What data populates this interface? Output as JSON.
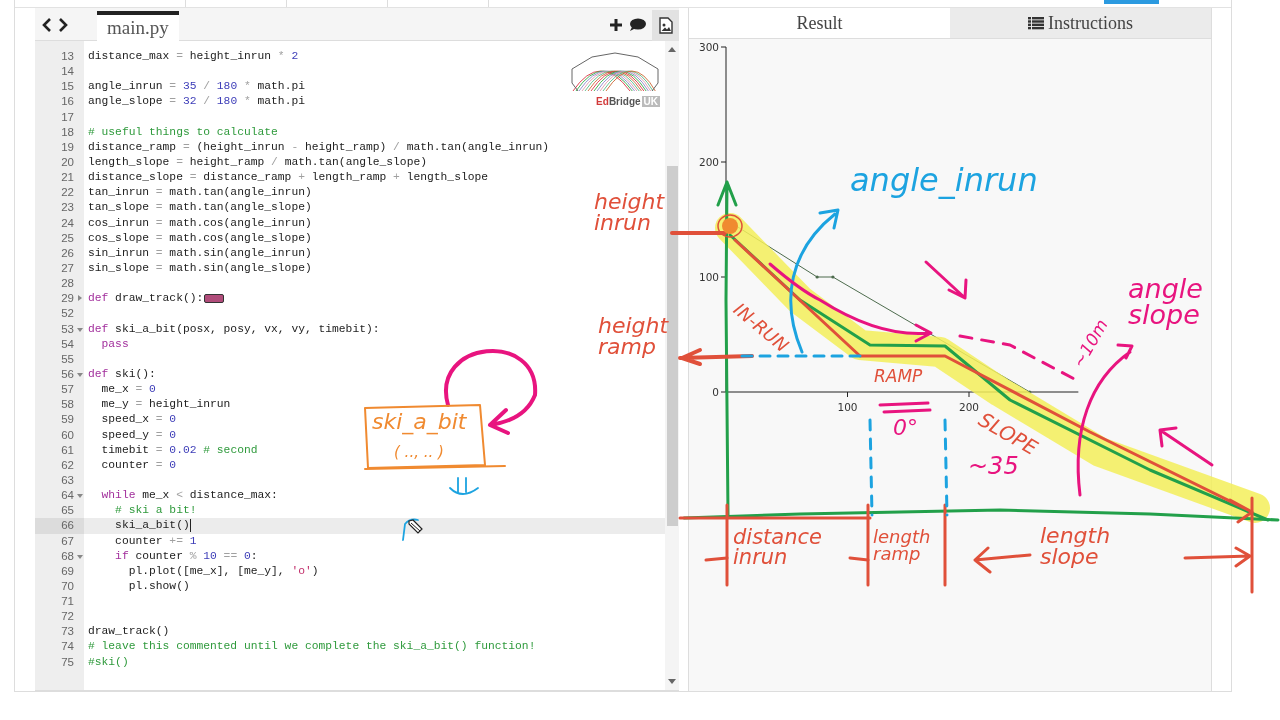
{
  "editor": {
    "file_tab": {
      "label": "main.py",
      "selected": true
    },
    "logo": {
      "wordmark": [
        "Ed",
        "Bridge"
      ],
      "badge": "UK"
    },
    "lines": [
      {
        "number": "13",
        "active": false,
        "tokens": [
          {
            "kind": "txt",
            "text": "distance_max "
          },
          {
            "kind": "op",
            "text": "= "
          },
          {
            "kind": "txt",
            "text": "height_inrun "
          },
          {
            "kind": "op",
            "text": "* "
          },
          {
            "kind": "num",
            "text": "2"
          }
        ]
      },
      {
        "number": "14",
        "active": false
      },
      {
        "number": "15",
        "active": false,
        "tokens": [
          {
            "kind": "txt",
            "text": "angle_inrun "
          },
          {
            "kind": "op",
            "text": "= "
          },
          {
            "kind": "num",
            "text": "35 "
          },
          {
            "kind": "op",
            "text": "/ "
          },
          {
            "kind": "num",
            "text": "180 "
          },
          {
            "kind": "op",
            "text": "* "
          },
          {
            "kind": "txt",
            "text": "math.pi"
          }
        ]
      },
      {
        "number": "16",
        "active": false,
        "tokens": [
          {
            "kind": "txt",
            "text": "angle_slope "
          },
          {
            "kind": "op",
            "text": "= "
          },
          {
            "kind": "num",
            "text": "32 "
          },
          {
            "kind": "op",
            "text": "/ "
          },
          {
            "kind": "num",
            "text": "180 "
          },
          {
            "kind": "op",
            "text": "* "
          },
          {
            "kind": "txt",
            "text": "math.pi"
          }
        ]
      },
      {
        "number": "17",
        "active": false
      },
      {
        "number": "18",
        "active": false,
        "tokens": [
          {
            "kind": "com",
            "text": "# useful things to calculate"
          }
        ]
      },
      {
        "number": "19",
        "active": false,
        "tokens": [
          {
            "kind": "txt",
            "text": "distance_ramp "
          },
          {
            "kind": "op",
            "text": "= "
          },
          {
            "kind": "txt",
            "text": "(height_inrun "
          },
          {
            "kind": "op",
            "text": "- "
          },
          {
            "kind": "txt",
            "text": "height_ramp) "
          },
          {
            "kind": "op",
            "text": "/ "
          },
          {
            "kind": "txt",
            "text": "math.tan(angle_inrun)"
          }
        ]
      },
      {
        "number": "20",
        "active": false,
        "tokens": [
          {
            "kind": "txt",
            "text": "length_slope "
          },
          {
            "kind": "op",
            "text": "= "
          },
          {
            "kind": "txt",
            "text": "height_ramp "
          },
          {
            "kind": "op",
            "text": "/ "
          },
          {
            "kind": "txt",
            "text": "math.tan(angle_slope)"
          }
        ]
      },
      {
        "number": "21",
        "active": false,
        "tokens": [
          {
            "kind": "txt",
            "text": "distance_slope "
          },
          {
            "kind": "op",
            "text": "= "
          },
          {
            "kind": "txt",
            "text": "distance_ramp "
          },
          {
            "kind": "op",
            "text": "+ "
          },
          {
            "kind": "txt",
            "text": "length_ramp "
          },
          {
            "kind": "op",
            "text": "+ "
          },
          {
            "kind": "txt",
            "text": "length_slope"
          }
        ]
      },
      {
        "number": "22",
        "active": false,
        "tokens": [
          {
            "kind": "txt",
            "text": "tan_inrun "
          },
          {
            "kind": "op",
            "text": "= "
          },
          {
            "kind": "txt",
            "text": "math.tan(angle_inrun)"
          }
        ]
      },
      {
        "number": "23",
        "active": false,
        "tokens": [
          {
            "kind": "txt",
            "text": "tan_slope "
          },
          {
            "kind": "op",
            "text": "= "
          },
          {
            "kind": "txt",
            "text": "math.tan(angle_slope)"
          }
        ]
      },
      {
        "number": "24",
        "active": false,
        "tokens": [
          {
            "kind": "txt",
            "text": "cos_inrun "
          },
          {
            "kind": "op",
            "text": "= "
          },
          {
            "kind": "txt",
            "text": "math.cos(angle_inrun)"
          }
        ]
      },
      {
        "number": "25",
        "active": false,
        "tokens": [
          {
            "kind": "txt",
            "text": "cos_slope "
          },
          {
            "kind": "op",
            "text": "= "
          },
          {
            "kind": "txt",
            "text": "math.cos(angle_slope)"
          }
        ]
      },
      {
        "number": "26",
        "active": false,
        "tokens": [
          {
            "kind": "txt",
            "text": "sin_inrun "
          },
          {
            "kind": "op",
            "text": "= "
          },
          {
            "kind": "txt",
            "text": "math.sin(angle_inrun)"
          }
        ]
      },
      {
        "number": "27",
        "active": false,
        "tokens": [
          {
            "kind": "txt",
            "text": "sin_slope "
          },
          {
            "kind": "op",
            "text": "= "
          },
          {
            "kind": "txt",
            "text": "math.sin(angle_slope)"
          }
        ]
      },
      {
        "number": "28",
        "active": false
      },
      {
        "number": "29",
        "active": false,
        "collapsed": true,
        "tokens": [
          {
            "kind": "kw",
            "text": "def"
          },
          {
            "kind": "txt",
            "text": " draw_track():"
          }
        ]
      },
      {
        "number": "52",
        "active": false
      },
      {
        "number": "53",
        "active": false,
        "collapsed": false,
        "tokens": [
          {
            "kind": "kw",
            "text": "def"
          },
          {
            "kind": "txt",
            "text": " ski_a_bit(posx, posy, vx, vy, timebit):"
          }
        ]
      },
      {
        "number": "54",
        "active": false,
        "tokens": [
          {
            "kind": "kw",
            "text": "  pass"
          }
        ]
      },
      {
        "number": "55",
        "active": false
      },
      {
        "number": "56",
        "active": false,
        "collapsed": false,
        "tokens": [
          {
            "kind": "kw",
            "text": "def"
          },
          {
            "kind": "txt",
            "text": " ski():"
          }
        ]
      },
      {
        "number": "57",
        "active": false,
        "tokens": [
          {
            "kind": "txt",
            "text": "  me_x "
          },
          {
            "kind": "op",
            "text": "= "
          },
          {
            "kind": "num",
            "text": "0"
          }
        ]
      },
      {
        "number": "58",
        "active": false,
        "tokens": [
          {
            "kind": "txt",
            "text": "  me_y "
          },
          {
            "kind": "op",
            "text": "= "
          },
          {
            "kind": "txt",
            "text": "height_inrun"
          }
        ]
      },
      {
        "number": "59",
        "active": false,
        "tokens": [
          {
            "kind": "txt",
            "text": "  speed_x "
          },
          {
            "kind": "op",
            "text": "= "
          },
          {
            "kind": "num",
            "text": "0"
          }
        ]
      },
      {
        "number": "60",
        "active": false,
        "tokens": [
          {
            "kind": "txt",
            "text": "  speed_y "
          },
          {
            "kind": "op",
            "text": "= "
          },
          {
            "kind": "num",
            "text": "0"
          }
        ]
      },
      {
        "number": "61",
        "active": false,
        "tokens": [
          {
            "kind": "txt",
            "text": "  timebit "
          },
          {
            "kind": "op",
            "text": "= "
          },
          {
            "kind": "num",
            "text": "0.02 "
          },
          {
            "kind": "com",
            "text": "# second"
          }
        ]
      },
      {
        "number": "62",
        "active": false,
        "tokens": [
          {
            "kind": "txt",
            "text": "  counter "
          },
          {
            "kind": "op",
            "text": "= "
          },
          {
            "kind": "num",
            "text": "0"
          }
        ]
      },
      {
        "number": "63",
        "active": false
      },
      {
        "number": "64",
        "active": false,
        "collapsed": false,
        "tokens": [
          {
            "kind": "kw",
            "text": "  while"
          },
          {
            "kind": "txt",
            "text": " me_x "
          },
          {
            "kind": "op",
            "text": "< "
          },
          {
            "kind": "txt",
            "text": "distance_max:"
          }
        ]
      },
      {
        "number": "65",
        "active": false,
        "tokens": [
          {
            "kind": "com",
            "text": "    # ski a bit!"
          }
        ]
      },
      {
        "number": "66",
        "active": true,
        "tokens": [
          {
            "kind": "txt",
            "text": "    ski_a_bit()"
          }
        ]
      },
      {
        "number": "67",
        "active": false,
        "tokens": [
          {
            "kind": "txt",
            "text": "    counter "
          },
          {
            "kind": "op",
            "text": "+= "
          },
          {
            "kind": "num",
            "text": "1"
          }
        ]
      },
      {
        "number": "68",
        "active": false,
        "collapsed": false,
        "tokens": [
          {
            "kind": "kw",
            "text": "    if"
          },
          {
            "kind": "txt",
            "text": " counter "
          },
          {
            "kind": "op",
            "text": "% "
          },
          {
            "kind": "num",
            "text": "10 "
          },
          {
            "kind": "op",
            "text": "== "
          },
          {
            "kind": "num",
            "text": "0"
          },
          {
            "kind": "txt",
            "text": ":"
          }
        ]
      },
      {
        "number": "69",
        "active": false,
        "tokens": [
          {
            "kind": "txt",
            "text": "      pl.plot([me_x], [me_y], "
          },
          {
            "kind": "str",
            "text": "'o'"
          },
          {
            "kind": "txt",
            "text": ")"
          }
        ]
      },
      {
        "number": "70",
        "active": false,
        "tokens": [
          {
            "kind": "txt",
            "text": "      pl.show()"
          }
        ]
      },
      {
        "number": "71",
        "active": false
      },
      {
        "number": "72",
        "active": false
      },
      {
        "number": "73",
        "active": false,
        "tokens": [
          {
            "kind": "txt",
            "text": "draw_track()"
          }
        ]
      },
      {
        "number": "74",
        "active": false,
        "tokens": [
          {
            "kind": "com",
            "text": "# leave this commented until we complete the ski_a_bit() function!"
          }
        ]
      },
      {
        "number": "75",
        "active": false,
        "tokens": [
          {
            "kind": "com",
            "text": "#ski()"
          }
        ]
      }
    ]
  },
  "results": {
    "tabs": [
      {
        "label": "Result",
        "selected": true
      },
      {
        "label": "Instructions",
        "selected": false
      }
    ],
    "chart_data": {
      "type": "line",
      "x": [
        0,
        75,
        88,
        250
      ],
      "series": [
        {
          "color": "#4d6b4d",
          "values": [
            150,
            100,
            100,
            0
          ]
        }
      ],
      "xlim": [
        0,
        290
      ],
      "ylim": [
        0,
        300
      ],
      "xticks": [
        100,
        200
      ],
      "yticks": [
        0,
        100,
        200,
        300
      ]
    }
  },
  "ink_annotations": [
    {
      "text": "ski_a_bit",
      "color": "#f08a30"
    },
    {
      "text": "( .., .. )",
      "color": "#f08a30"
    },
    {
      "text": "height\ninrun",
      "color": "#e0503a"
    },
    {
      "text": "height\nramp",
      "color": "#e0503a"
    },
    {
      "text": "angle_inrun",
      "color": "#1ca3e0"
    },
    {
      "text": "IN-RUN",
      "color": "#e0503a"
    },
    {
      "text": "RAMP",
      "color": "#e0503a"
    },
    {
      "text": "SLOPE",
      "color": "#e0503a"
    },
    {
      "text": "angle\nslope",
      "color": "#e8147f"
    },
    {
      "text": "~10m",
      "color": "#e8147f"
    },
    {
      "text": "0°",
      "color": "#e8147f"
    },
    {
      "text": "~35",
      "color": "#e8147f"
    },
    {
      "text": "distance\ninrun",
      "color": "#e0503a"
    },
    {
      "text": "length\nramp",
      "color": "#e0503a"
    },
    {
      "text": "length\nslope",
      "color": "#e0503a"
    }
  ]
}
